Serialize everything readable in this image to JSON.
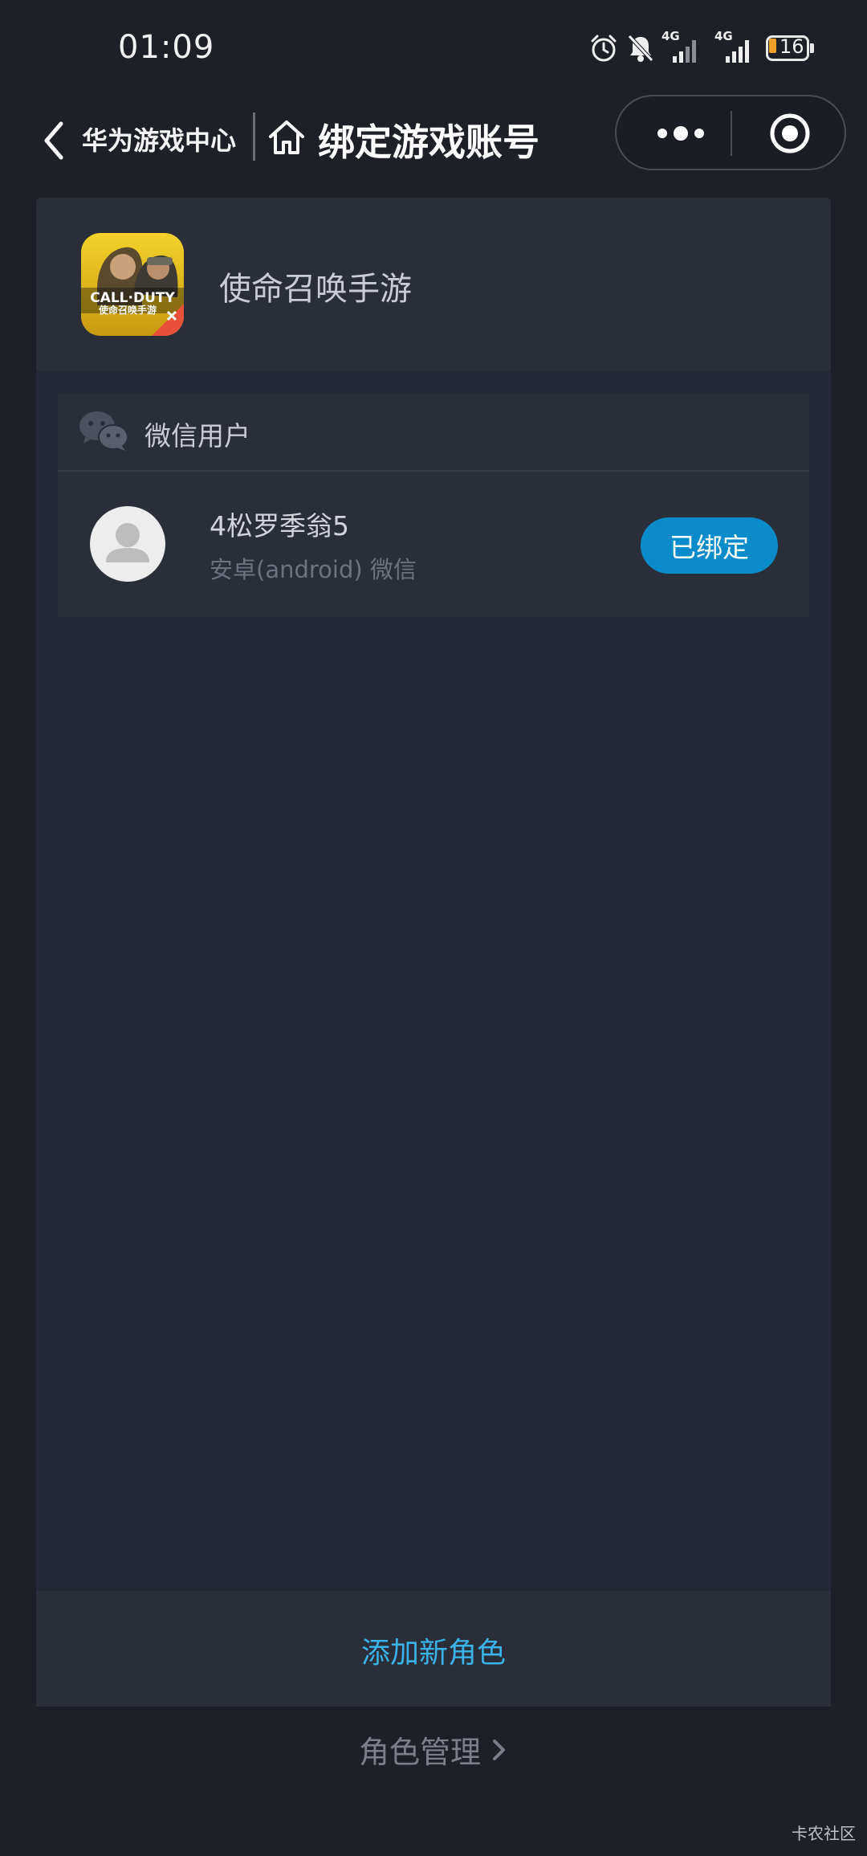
{
  "status_bar": {
    "time": "01:09",
    "network_1": "4G",
    "network_2": "4G",
    "battery": "16"
  },
  "nav": {
    "source": "华为游戏中心",
    "title": "绑定游戏账号"
  },
  "game": {
    "name": "使命召唤手游",
    "icon_text_line1": "CALL·DUTY",
    "icon_text_line2": "使命召唤手游"
  },
  "account": {
    "type": "微信用户",
    "nickname": "4松罗季翁5",
    "platform": "安卓(android) 微信",
    "status_button": "已绑定"
  },
  "actions": {
    "add_role": "添加新角色",
    "role_manage": "角色管理"
  },
  "watermark": "卡农社区",
  "colors": {
    "background": "#1e2028",
    "card": "#2a2e39",
    "panel": "#242834",
    "accent_button": "#0a8ccb",
    "link": "#3ab2ea",
    "battery_low": "#f0a028"
  }
}
